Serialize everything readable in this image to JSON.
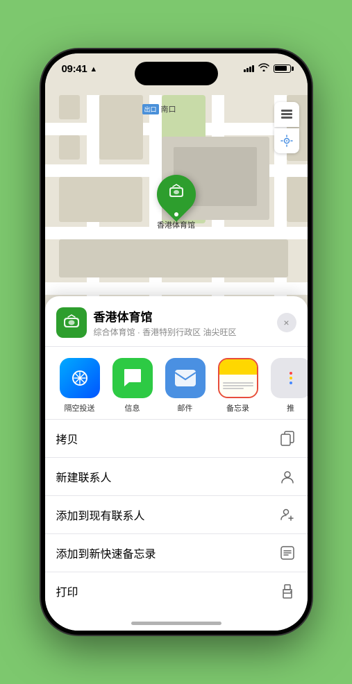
{
  "status_bar": {
    "time": "09:41",
    "location_arrow": "▲"
  },
  "map": {
    "label_tag": "出口",
    "label_name": "南口",
    "venue_pin_name": "香港体育馆",
    "venue_pin_icon": "🏟"
  },
  "map_controls": {
    "layers_icon": "🗺",
    "location_icon": "➤"
  },
  "venue_header": {
    "title": "香港体育馆",
    "subtitle": "综合体育馆 · 香港特别行政区 油尖旺区",
    "close_label": "×"
  },
  "share_items": [
    {
      "id": "airdrop",
      "label": "隔空投送",
      "icon": "📡"
    },
    {
      "id": "messages",
      "label": "信息",
      "icon": "💬"
    },
    {
      "id": "mail",
      "label": "邮件",
      "icon": "✉"
    },
    {
      "id": "notes",
      "label": "备忘录",
      "icon": "📝"
    },
    {
      "id": "more",
      "label": "推",
      "icon": "···"
    }
  ],
  "action_items": [
    {
      "id": "copy",
      "label": "拷贝",
      "icon": "copy"
    },
    {
      "id": "new-contact",
      "label": "新建联系人",
      "icon": "person"
    },
    {
      "id": "add-existing",
      "label": "添加到现有联系人",
      "icon": "person-add"
    },
    {
      "id": "quick-note",
      "label": "添加到新快速备忘录",
      "icon": "note"
    },
    {
      "id": "print",
      "label": "打印",
      "icon": "print"
    }
  ]
}
